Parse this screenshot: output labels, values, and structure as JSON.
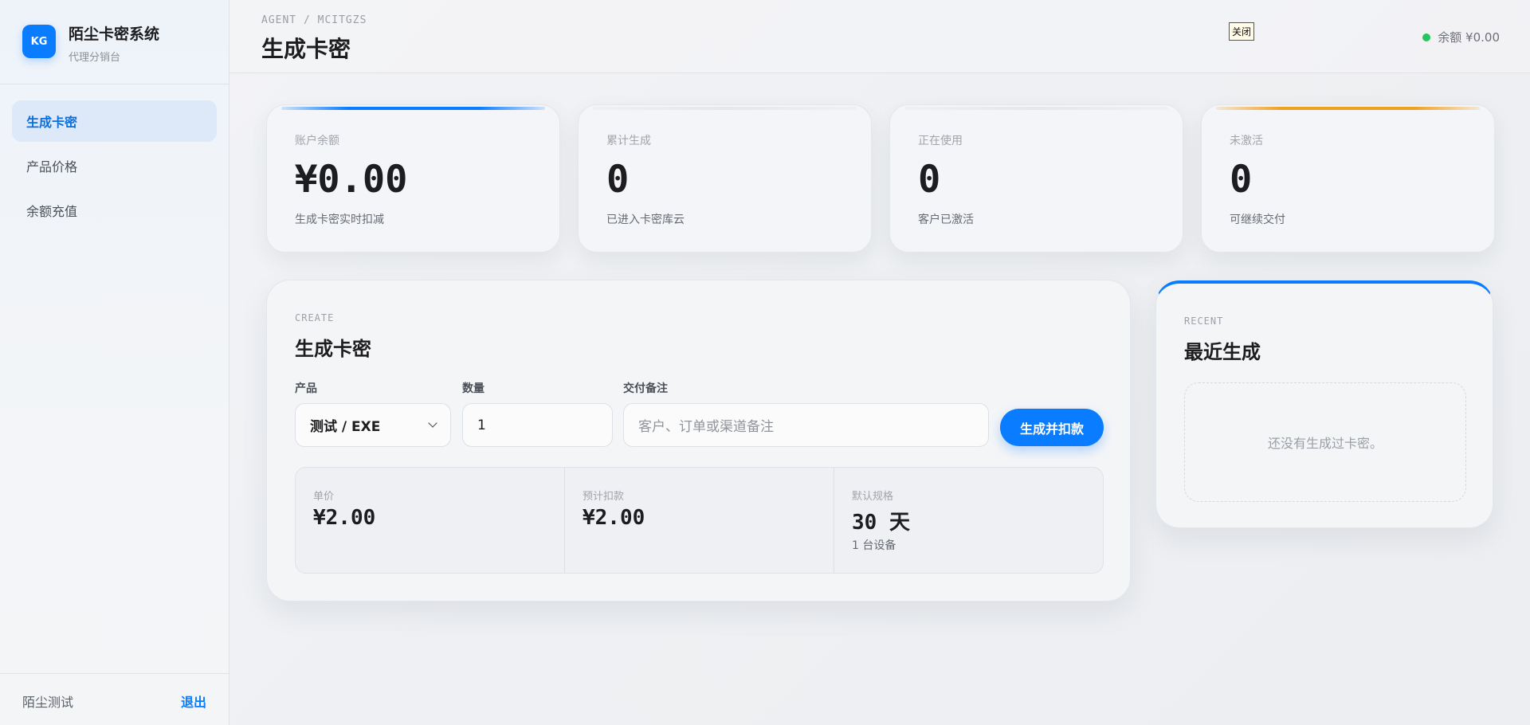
{
  "brand": {
    "logo_text": "KG",
    "title": "陌尘卡密系统",
    "subtitle": "代理分销台"
  },
  "nav": [
    {
      "label": "生成卡密",
      "active": true
    },
    {
      "label": "产品价格",
      "active": false
    },
    {
      "label": "余额充值",
      "active": false
    }
  ],
  "footer": {
    "user": "陌尘测试",
    "logout": "退出"
  },
  "header": {
    "breadcrumb": "AGENT / MCITGZS",
    "title": "生成卡密",
    "close_label": "关闭",
    "balance": "余额 ¥0.00",
    "status_color": "#22c55e"
  },
  "stats": [
    {
      "label": "账户余额",
      "value": "¥0.00",
      "note": "生成卡密实时扣减",
      "accent": "#0a7cff"
    },
    {
      "label": "累计生成",
      "value": "0",
      "note": "已进入卡密库云",
      "accent": ""
    },
    {
      "label": "正在使用",
      "value": "0",
      "note": "客户已激活",
      "accent": ""
    },
    {
      "label": "未激活",
      "value": "0",
      "note": "可继续交付",
      "accent": "#f0a020"
    }
  ],
  "create": {
    "eyebrow": "CREATE",
    "title": "生成卡密",
    "product_label": "产品",
    "product_value": "测试 / EXE",
    "quantity_label": "数量",
    "quantity_value": "1",
    "note_label": "交付备注",
    "note_placeholder": "客户、订单或渠道备注",
    "submit": "生成并扣款",
    "summary": [
      {
        "label": "单价",
        "value": "¥2.00",
        "note": ""
      },
      {
        "label": "预计扣款",
        "value": "¥2.00",
        "note": ""
      },
      {
        "label": "默认规格",
        "value": "30 天",
        "note": "1 台设备"
      }
    ]
  },
  "recent": {
    "eyebrow": "RECENT",
    "title": "最近生成",
    "empty": "还没有生成过卡密。"
  },
  "colors": {
    "accent": "#0a7cff",
    "warning": "#f0a020"
  }
}
